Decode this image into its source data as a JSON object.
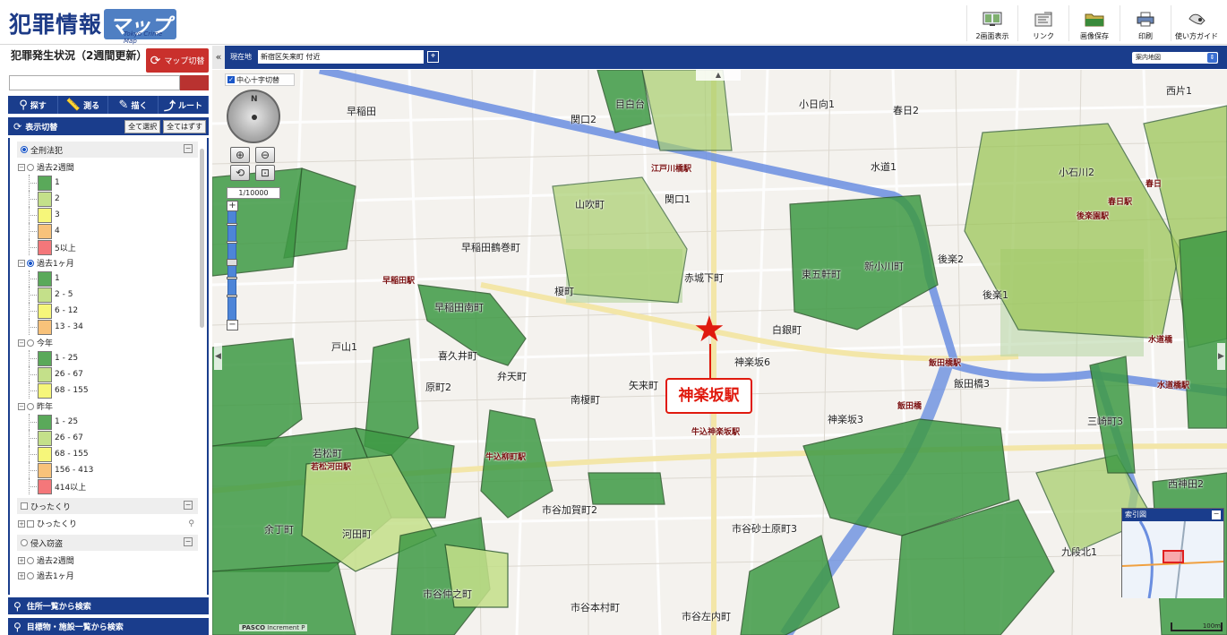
{
  "header": {
    "logo_jp": "犯罪情報",
    "logo_map": "マップ",
    "logo_sub": "Tokyo Crime Map",
    "tools": [
      {
        "icon": "split-screen-icon",
        "label": "2画面表示"
      },
      {
        "icon": "link-icon",
        "label": "リンク"
      },
      {
        "icon": "folder-icon",
        "label": "画像保存"
      },
      {
        "icon": "printer-icon",
        "label": "印刷"
      },
      {
        "icon": "guide-icon",
        "label": "使い方ガイド"
      }
    ]
  },
  "sidebar": {
    "title": "犯罪発生状況（2週間更新）",
    "map_switch": "マップ切替",
    "actions": [
      "探す",
      "測る",
      "描く",
      "ルート"
    ],
    "display_toggle": "表示切替",
    "select_all": "全て選択",
    "deselect_all": "全てはずす",
    "section_all": "全刑法犯",
    "groups": [
      {
        "label": "過去2週間",
        "selected": false,
        "items": [
          "1",
          "2",
          "3",
          "4",
          "5以上"
        ]
      },
      {
        "label": "過去1ヶ月",
        "selected": true,
        "items": [
          "1",
          "2 - 5",
          "6 - 12",
          "13 - 34"
        ]
      },
      {
        "label": "今年",
        "selected": false,
        "items": [
          "1 - 25",
          "26 - 67",
          "68 - 155"
        ]
      },
      {
        "label": "昨年",
        "selected": false,
        "items": [
          "1 - 25",
          "26 - 67",
          "68 - 155",
          "156 - 413",
          "414以上"
        ]
      }
    ],
    "section_snatch": "ひったくり",
    "snatch_item": "ひったくり",
    "section_burglary": "侵入窃盗",
    "burglary_items": [
      "過去2週間",
      "過去1ヶ月"
    ],
    "search_by_address": "住所一覧から検索",
    "search_by_landmark": "目標物・施設一覧から検索",
    "colors": {
      "lvl1": "#5aa95a",
      "lvl2": "#c4e08a",
      "lvl3": "#f6f67a",
      "lvl4": "#f8c27a",
      "lvl5": "#f4777a",
      "navy": "#1a3d8c",
      "accent_red": "#c9302c"
    }
  },
  "mapbar": {
    "current_location_label": "現在地",
    "current_location": "新宿区矢来町 付近",
    "map_type": "案内地図"
  },
  "map": {
    "center_toggle": "中心十字切替",
    "scale": "1/10000",
    "station_name": "神楽坂駅",
    "index_map_title": "索引図",
    "credit_brand": "PASCO",
    "credit_other": "Increment P",
    "scale_bar": "100m",
    "labels": [
      "早稲田",
      "関口2",
      "関口1",
      "目白台",
      "小日向1",
      "春日2",
      "水道1",
      "小石川2",
      "西片1",
      "山吹町",
      "早稲田鶴巻町",
      "榎町",
      "赤城下町",
      "東五軒町",
      "新小川町",
      "後楽2",
      "後楽1",
      "早稲田南町",
      "白銀町",
      "喜久井町",
      "弁天町",
      "原町2",
      "南榎町",
      "矢来町",
      "神楽坂6",
      "戸山1",
      "若松町",
      "若松河田駅",
      "市谷加賀町2",
      "市谷砂土原町3",
      "神楽坂3",
      "飯田橋3",
      "三崎町3",
      "西神田2",
      "余丁町",
      "河田町",
      "市谷仲之町",
      "市谷本村町",
      "市谷左内町",
      "九段北1",
      "春日",
      "水道橋",
      "飯田橋"
    ],
    "stations": [
      "江戸川橋駅",
      "早稲田駅",
      "牛込柳町駅",
      "牛込神楽坂駅",
      "飯田橋駅",
      "後楽園駅",
      "水道橋駅",
      "春日駅"
    ]
  }
}
